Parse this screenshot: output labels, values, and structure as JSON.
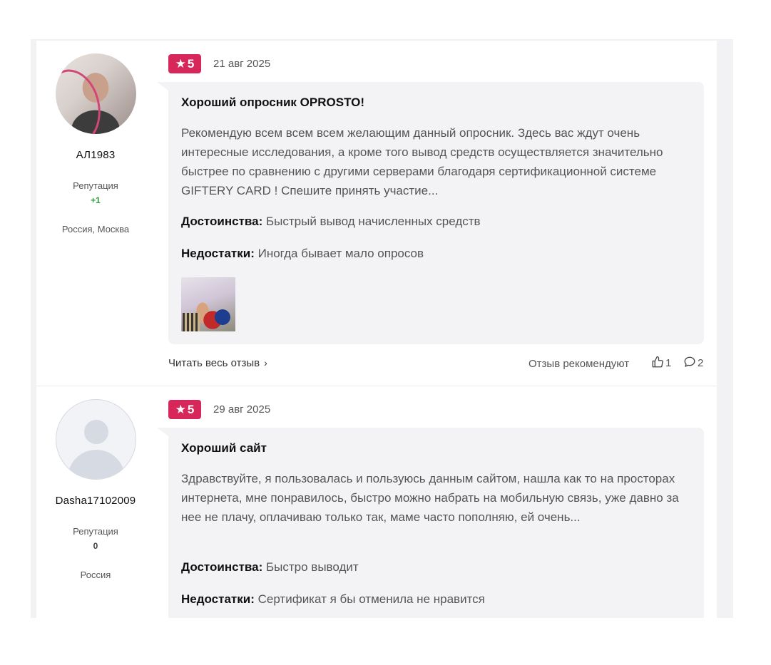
{
  "reviews": [
    {
      "author": "АЛ1983",
      "reputation_label": "Репутация",
      "reputation_value": "+1",
      "location": "Россия, Москва",
      "rating": "5",
      "date": "21 авг 2025",
      "title": "Хороший опросник OPROSTO!",
      "text": "Рекомендую всем всем всем желающим данный опросник. Здесь вас ждут очень интересные исследования, а кроме того вывод средств осуществляется значительно быстрее по сравнению с другими серверами благодаря сертификационной системе GIFTERY CARD ! Спешите принять участие...",
      "pros_label": "Достоинства:",
      "pros": "Быстрый вывод начисленных средств",
      "cons_label": "Недостатки:",
      "cons": "Иногда бывает мало опросов",
      "read_more": "Читать весь отзыв",
      "recommend_label": "Отзыв рекомендуют",
      "likes": "1",
      "comments": "2"
    },
    {
      "author": "Dasha17102009",
      "reputation_label": "Репутация",
      "reputation_value": "0",
      "location": "Россия",
      "rating": "5",
      "date": "29 авг 2025",
      "title": "Хороший сайт",
      "text": "Здравствуйте, я пользовалась и пользуюсь данным сайтом, нашла как то на просторах интернета, мне понравилось, быстро можно набрать на мобильную связь, уже давно за нее не плачу, оплачиваю только так, маме часто пополняю, ей очень...",
      "pros_label": "Достоинства:",
      "pros": "Быстро выводит",
      "cons_label": "Недостатки:",
      "cons": "Сертификат я бы отменила не нравится"
    }
  ],
  "colors": {
    "rating_badge": "#d6265a",
    "reputation_positive": "#2e9e3a",
    "bubble_bg": "#f3f3f5"
  },
  "icons": {
    "rating": "star-icon",
    "read_more": "chevron-right-icon",
    "likes": "thumbs-up-icon",
    "comments": "comment-bubble-icon"
  }
}
